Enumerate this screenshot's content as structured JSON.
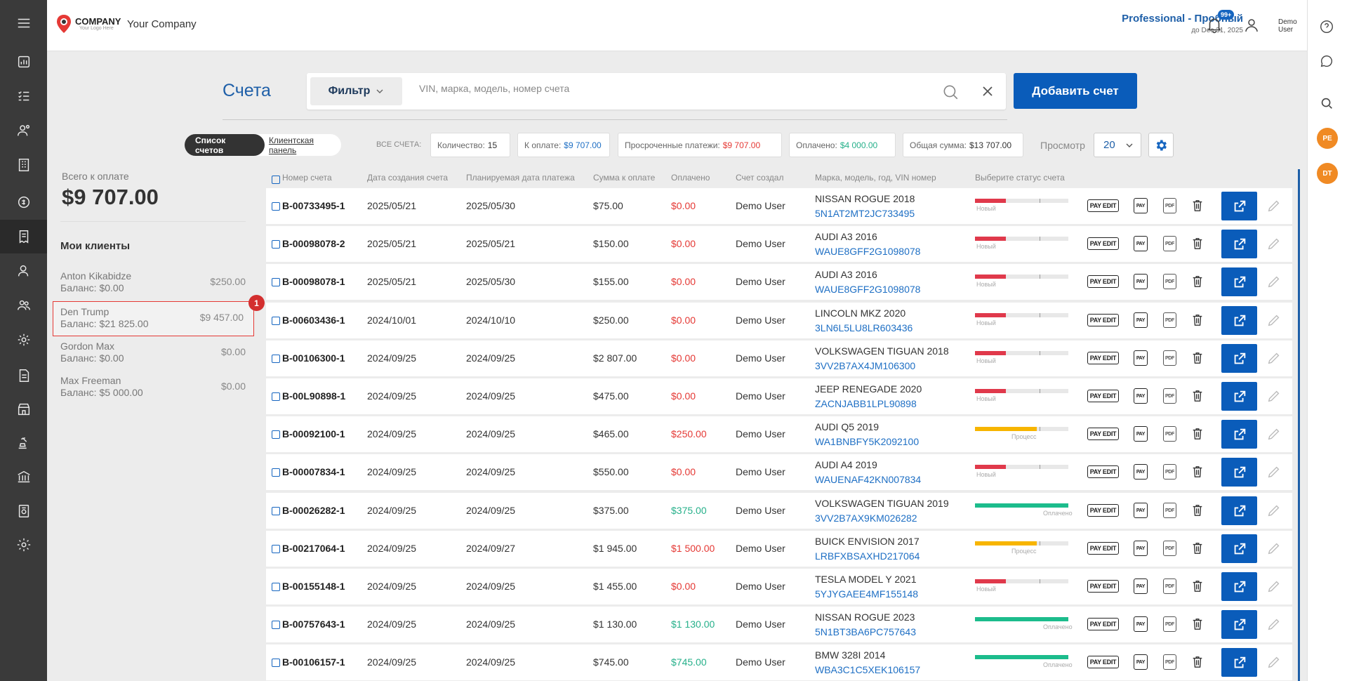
{
  "app": {
    "company_name": "Your Company",
    "logo_text": "COMPANY",
    "logo_sub": "Your Logo Here"
  },
  "header": {
    "plan": "Professional - Пробный",
    "plan_until": "до Dec 31, 2025",
    "notif_count": "99+",
    "user_line1": "Demo",
    "user_line2": "User"
  },
  "page": {
    "title": "Счета",
    "filter_label": "Фильтр",
    "search_placeholder": "VIN, марка, модель, номер счета",
    "add_button": "Добавить счет"
  },
  "toggle": {
    "list": "Список счетов",
    "panel": "Клиентская панель"
  },
  "stats": {
    "all_label": "ВСЕ СЧЕТА:",
    "count_label": "Количество:",
    "count_value": "15",
    "due_label": "К оплате:",
    "due_value": "$9 707.00",
    "overdue_label": "Просроченные платежи:",
    "overdue_value": "$9 707.00",
    "paid_label": "Оплачено:",
    "paid_value": "$4 000.00",
    "sum_label": "Общая сумма:",
    "sum_value": "$13 707.00"
  },
  "view": {
    "label": "Просмотр",
    "value": "20"
  },
  "left_panel": {
    "total_label": "Всего к оплате",
    "total_value": "$9 707.00",
    "clients_title": "Мои клиенты",
    "clients": [
      {
        "name": "Anton Kikabidze",
        "balance": "Баланс: $0.00",
        "value": "$250.00"
      },
      {
        "name": "Den Trump",
        "balance": "Баланс: $21 825.00",
        "value": "$9 457.00",
        "badge": "1"
      },
      {
        "name": "Gordon Max",
        "balance": "Баланс: $0.00",
        "value": "$0.00"
      },
      {
        "name": "Max Freeman",
        "balance": "Баланс: $5 000.00",
        "value": "$0.00"
      }
    ]
  },
  "table": {
    "headers": [
      "Номер счета",
      "Дата создания счета",
      "Планируемая дата платежа",
      "Сумма к оплате",
      "Оплачено",
      "Счет создал",
      "Марка, модель, год, VIN номер",
      "Выберите статус счета"
    ],
    "action_labels": {
      "pay_edit": "PAY EDIT",
      "pay": "PAY",
      "pdf": "PDF"
    },
    "rows": [
      {
        "num": "B-00733495-1",
        "created": "2025/05/21",
        "planned": "2025/05/30",
        "amount": "$75.00",
        "paid": "$0.00",
        "paid_color": "red",
        "creator": "Demo User",
        "car": "NISSAN ROGUE 2018",
        "vin": "5N1AT2MT2JC733495",
        "status": "Новый",
        "progress": 0.33
      },
      {
        "num": "B-00098078-2",
        "created": "2025/05/21",
        "planned": "2025/05/21",
        "amount": "$150.00",
        "paid": "$0.00",
        "paid_color": "red",
        "creator": "Demo User",
        "car": "AUDI A3 2016",
        "vin": "WAUE8GFF2G1098078",
        "status": "Новый",
        "progress": 0.33
      },
      {
        "num": "B-00098078-1",
        "created": "2025/05/21",
        "planned": "2025/05/30",
        "amount": "$155.00",
        "paid": "$0.00",
        "paid_color": "red",
        "creator": "Demo User",
        "car": "AUDI A3 2016",
        "vin": "WAUE8GFF2G1098078",
        "status": "Новый",
        "progress": 0.33
      },
      {
        "num": "B-00603436-1",
        "created": "2024/10/01",
        "planned": "2024/10/10",
        "amount": "$250.00",
        "paid": "$0.00",
        "paid_color": "red",
        "creator": "Demo User",
        "car": "LINCOLN MKZ 2020",
        "vin": "3LN6L5LU8LR603436",
        "status": "Новый",
        "progress": 0.33
      },
      {
        "num": "B-00106300-1",
        "created": "2024/09/25",
        "planned": "2024/09/25",
        "amount": "$2 807.00",
        "paid": "$0.00",
        "paid_color": "red",
        "creator": "Demo User",
        "car": "VOLKSWAGEN TIGUAN 2018",
        "vin": "3VV2B7AX4JM106300",
        "status": "Новый",
        "progress": 0.33
      },
      {
        "num": "B-00L90898-1",
        "created": "2024/09/25",
        "planned": "2024/09/25",
        "amount": "$475.00",
        "paid": "$0.00",
        "paid_color": "red",
        "creator": "Demo User",
        "car": "JEEP RENEGADE 2020",
        "vin": "ZACNJABB1LPL90898",
        "status": "Новый",
        "progress": 0.33
      },
      {
        "num": "B-00092100-1",
        "created": "2024/09/25",
        "planned": "2024/09/25",
        "amount": "$465.00",
        "paid": "$250.00",
        "paid_color": "red",
        "creator": "Demo User",
        "car": "AUDI Q5 2019",
        "vin": "WA1BNBFY5K2092100",
        "status": "Процесс",
        "progress": 0.66
      },
      {
        "num": "B-00007834-1",
        "created": "2024/09/25",
        "planned": "2024/09/25",
        "amount": "$550.00",
        "paid": "$0.00",
        "paid_color": "red",
        "creator": "Demo User",
        "car": "AUDI A4 2019",
        "vin": "WAUENAF42KN007834",
        "status": "Новый",
        "progress": 0.33
      },
      {
        "num": "B-00026282-1",
        "created": "2024/09/25",
        "planned": "2024/09/25",
        "amount": "$375.00",
        "paid": "$375.00",
        "paid_color": "green",
        "creator": "Demo User",
        "car": "VOLKSWAGEN TIGUAN 2019",
        "vin": "3VV2B7AX9KM026282",
        "status": "Оплачено",
        "progress": 1.0
      },
      {
        "num": "B-00217064-1",
        "created": "2024/09/25",
        "planned": "2024/09/27",
        "amount": "$1 945.00",
        "paid": "$1 500.00",
        "paid_color": "red",
        "creator": "Demo User",
        "car": "BUICK ENVISION 2017",
        "vin": "LRBFXBSAXHD217064",
        "status": "Процесс",
        "progress": 0.66
      },
      {
        "num": "B-00155148-1",
        "created": "2024/09/25",
        "planned": "2024/09/25",
        "amount": "$1 455.00",
        "paid": "$0.00",
        "paid_color": "red",
        "creator": "Demo User",
        "car": "TESLA MODEL Y 2021",
        "vin": "5YJYGAEE4MF155148",
        "status": "Новый",
        "progress": 0.33
      },
      {
        "num": "B-00757643-1",
        "created": "2024/09/25",
        "planned": "2024/09/25",
        "amount": "$1 130.00",
        "paid": "$1 130.00",
        "paid_color": "green",
        "creator": "Demo User",
        "car": "NISSAN ROGUE 2023",
        "vin": "5N1BT3BA6PC757643",
        "status": "Оплачено",
        "progress": 1.0
      },
      {
        "num": "B-00106157-1",
        "created": "2024/09/25",
        "planned": "2024/09/25",
        "amount": "$745.00",
        "paid": "$745.00",
        "paid_color": "green",
        "creator": "Demo User",
        "car": "BMW 328I 2014",
        "vin": "WBA3C1C5XEK106157",
        "status": "Оплачено",
        "progress": 1.0
      }
    ]
  },
  "right_bar": {
    "avatar1": "PE",
    "avatar2": "DT"
  },
  "colors": {
    "accent": "#0a5cba",
    "title": "#1e5fa8",
    "new": "#e0394b",
    "process": "#f7b500",
    "paid": "#1cbc8c"
  },
  "sidebar_icons": [
    "menu-icon",
    "dashboard-icon",
    "tasks-icon",
    "clients-icon",
    "inventory-icon",
    "finance-icon",
    "invoices-icon",
    "user-icon",
    "users-icon",
    "user-settings-icon",
    "document-icon",
    "store-icon",
    "auction-icon",
    "bank-icon",
    "reports-icon",
    "settings-icon"
  ]
}
